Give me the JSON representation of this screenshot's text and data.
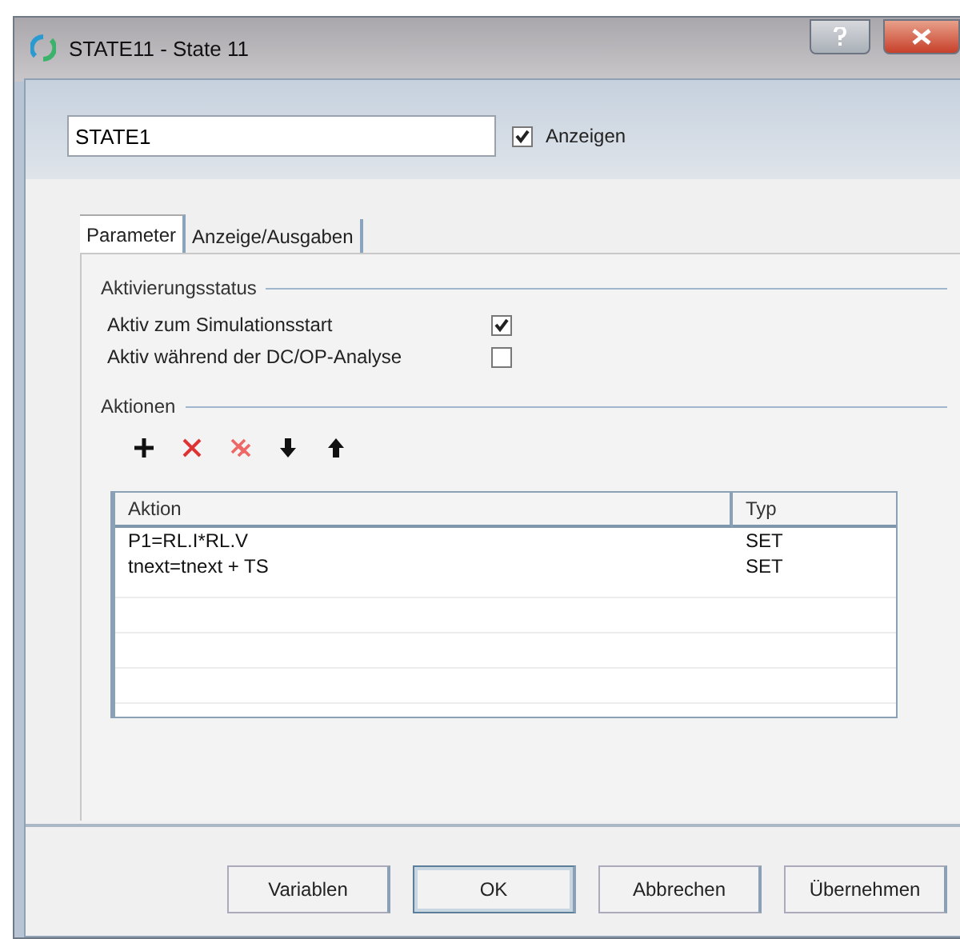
{
  "window": {
    "title": "STATE11 - State 11"
  },
  "name_field": {
    "value": "STATE1"
  },
  "show_checkbox": {
    "label": "Anzeigen",
    "checked": true
  },
  "tabs": [
    {
      "label": "Parameter",
      "selected": true
    },
    {
      "label": "Anzeige/Ausgaben",
      "selected": false
    }
  ],
  "activation": {
    "title": "Aktivierungsstatus",
    "options": [
      {
        "label": "Aktiv zum Simulationsstart",
        "checked": true
      },
      {
        "label": "Aktiv während der DC/OP-Analyse",
        "checked": false
      }
    ]
  },
  "actions": {
    "title": "Aktionen",
    "toolbar": [
      {
        "kind": "add"
      },
      {
        "kind": "delete"
      },
      {
        "kind": "delete-all"
      },
      {
        "kind": "down"
      },
      {
        "kind": "up"
      }
    ],
    "columns": [
      "Aktion",
      "Typ"
    ],
    "rows": [
      [
        "P1=RL.I*RL.V",
        "SET"
      ],
      [
        "tnext=tnext + TS",
        "SET"
      ]
    ]
  },
  "buttons": [
    {
      "label": "Variablen",
      "default": false
    },
    {
      "label": "OK",
      "default": true
    },
    {
      "label": "Abbrechen",
      "default": false
    },
    {
      "label": "Übernehmen",
      "default": false
    }
  ]
}
